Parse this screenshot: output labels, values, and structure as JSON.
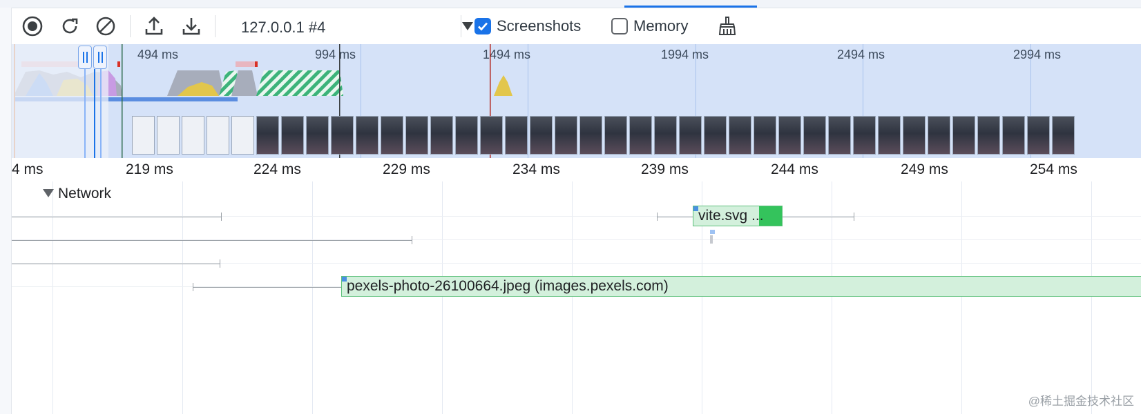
{
  "colors": {
    "accent": "#1a73e8",
    "overview_bg": "#d5e2f8",
    "request_bg": "#d3f0dc",
    "request_border": "#5cc07a",
    "request_receive": "#34c35c",
    "marker_red": "#b3261e"
  },
  "toolbar": {
    "record_icon": "record-icon",
    "reload_icon": "reload-record-icon",
    "clear_icon": "clear-icon",
    "upload_icon": "load-profile-icon",
    "download_icon": "save-profile-icon",
    "target": "127.0.0.1 #4",
    "screenshots_label": "Screenshots",
    "screenshots_checked": true,
    "memory_label": "Memory",
    "memory_checked": false,
    "gc_icon": "garbage-collect-icon"
  },
  "overview": {
    "ticks": [
      "494 ms",
      "994 ms",
      "1494 ms",
      "1994 ms",
      "2494 ms",
      "2994 ms"
    ],
    "screenshot_count": 38
  },
  "ruler": {
    "ticks": [
      "4 ms",
      "219 ms",
      "224 ms",
      "229 ms",
      "234 ms",
      "239 ms",
      "244 ms",
      "249 ms",
      "254 ms"
    ]
  },
  "flame": {
    "track_label": "Network",
    "requests": [
      {
        "label": "vite.svg ..."
      },
      {
        "label": "pexels-photo-26100664.jpeg (images.pexels.com)"
      }
    ]
  },
  "watermark": "@稀土掘金技术社区"
}
